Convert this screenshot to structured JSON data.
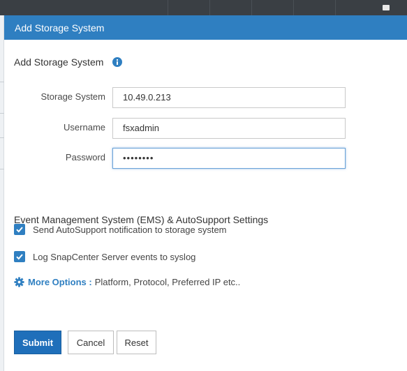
{
  "dialog": {
    "title": "Add Storage System"
  },
  "section": {
    "title": "Add Storage System"
  },
  "form": {
    "storage_system": {
      "label": "Storage System",
      "value": "10.49.0.213"
    },
    "username": {
      "label": "Username",
      "value": "fsxadmin"
    },
    "password": {
      "label": "Password",
      "value": "••••••••"
    }
  },
  "ems": {
    "title": "Event Management System (EMS) & AutoSupport Settings",
    "options": [
      {
        "label": "Send AutoSupport notification to storage system",
        "checked": true
      },
      {
        "label": "Log SnapCenter Server events to syslog",
        "checked": true
      }
    ]
  },
  "more_options": {
    "link": "More Options :",
    "text": "Platform, Protocol, Preferred IP etc.."
  },
  "buttons": {
    "submit": "Submit",
    "cancel": "Cancel",
    "reset": "Reset"
  },
  "colors": {
    "header_bg": "#2f7fc1",
    "accent": "#2f7fc1",
    "submit_bg": "#1f6fba"
  },
  "icons": {
    "info": "info-icon",
    "gear": "gear-icon",
    "check": "check-icon"
  }
}
